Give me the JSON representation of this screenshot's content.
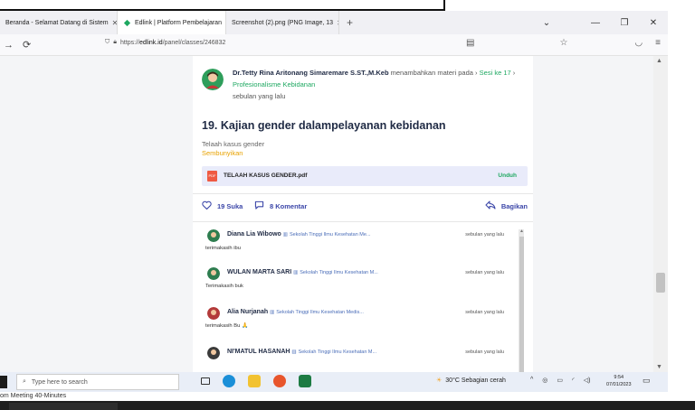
{
  "browser": {
    "tabs": [
      {
        "label": "Beranda - Selamat Datang di Sistem",
        "active": false
      },
      {
        "label": "Edlink | Platform Pembelajaran",
        "active": true
      },
      {
        "label": "Screenshot (2).png (PNG Image, 13",
        "active": false
      }
    ],
    "url_prefix": "https://",
    "url_domain": "edlink.id",
    "url_path": "/panel/classes/246832"
  },
  "post": {
    "author_name": "Dr.Tetty Rina Aritonang Simaremare S.ST.,M.Keb",
    "action_text": "menambahkan materi pada",
    "session_label": "Sesi ke 17",
    "topic_label": "Profesionalisme Kebidanan",
    "time": "sebulan yang lalu",
    "title": "19. Kajian gender dalampelayanan kebidanan",
    "description": "Telaah kasus gender",
    "hide_link": "Sembunyikan",
    "file_name": "TELAAH KASUS GENDER.pdf",
    "file_type_label": "PDF",
    "download_label": "Unduh",
    "likes_label": "19 Suka",
    "comments_label": "8 Komentar",
    "share_label": "Bagikan"
  },
  "comments": [
    {
      "name": "Diana Lia Wibowo",
      "institution": "Sekolah Tinggi Ilmu Kesehatan Me...",
      "time": "sebulan yang lalu",
      "text": "terimakasih ibu"
    },
    {
      "name": "WULAN MARTA SARI",
      "institution": "Sekolah Tinggi Ilmu Kesehatan M...",
      "time": "sebulan yang lalu",
      "text": "Terimakasih buk"
    },
    {
      "name": "Alia Nurjanah",
      "institution": "Sekolah Tinggi Ilmu Kesehatan Medis...",
      "time": "sebulan yang lalu",
      "text": "terimakasih Bu 🙏"
    },
    {
      "name": "NI'MATUL HASANAH",
      "institution": "Sekolah Tinggi Ilmu Kesehatan M...",
      "time": "sebulan yang lalu",
      "text": ""
    }
  ],
  "taskbar": {
    "search_placeholder": "Type here to search",
    "weather": "30°C  Sebagian cerah",
    "time": "9:54",
    "date": "07/01/2023"
  },
  "meeting_label": "om Meeting 40-Minutes",
  "colors": {
    "accent_green": "#1ea861",
    "action_blue": "#3b46a8",
    "title_navy": "#1f2a44"
  }
}
